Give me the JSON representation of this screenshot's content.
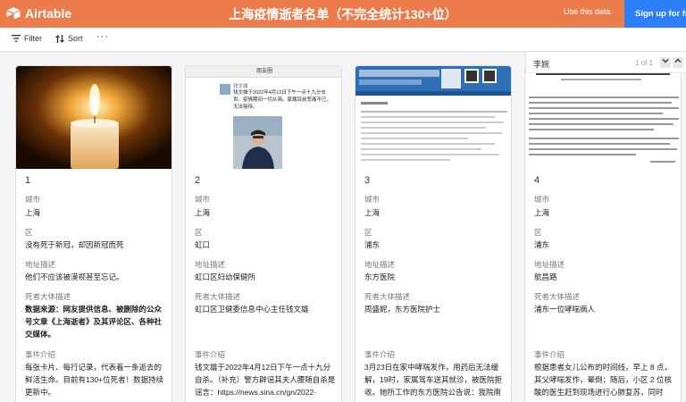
{
  "app": {
    "brand": "Airtable",
    "title": "上海疫情逝者名单（不完全统计130+位）",
    "use_data_label": "Use this data",
    "signup_label": "Sign up for free"
  },
  "toolbar": {
    "filter_label": "Filter",
    "sort_label": "Sort",
    "more_label": "···"
  },
  "field_labels": {
    "city": "城市",
    "district": "区",
    "address": "地址描述",
    "description": "死者大体描述",
    "event": "事件介绍"
  },
  "cards": [
    {
      "num": "1",
      "city": "上海",
      "district": "没有死于新冠，却因新冠而死",
      "address": "他们不应该被漠视甚至忘记。",
      "description": "数据来源：网友提供信息、被删除的公众号文章《上海逝者》及其评论区、各种社交媒体。",
      "event": "每张卡片、每行记录，代表着一条逝去的鲜活生命。目前有130+位死者！数据持续更新中。"
    },
    {
      "num": "2",
      "city": "上海",
      "district": "虹口",
      "address": "虹口区妇幼保健所",
      "description": "虹口区卫健委信息中心主任钱文雄",
      "event": "钱文雄于2022年4月12日下午一点十九分自杀。（补充）警方辟谣其夫人腰随自杀是谣言：https://news.sina.cn/gn/2022-",
      "screenshot_header": "朋友圈",
      "screenshot_name": "钱文雄",
      "screenshot_text": "钱文雄于2022年4月12日下午一点十九分去世。疫情期间一切从简。家属目前悲痛不已，无法接待。"
    },
    {
      "num": "3",
      "city": "上海",
      "district": "浦东",
      "address": "东方医院",
      "description": "周盛妮，东方医院护士",
      "event": "3月23日在家中哮喘发作，用药后无法缓解，19时，家属驾车送其就诊，被医院拒收。她所工作的东方医院公告说：我院南"
    },
    {
      "num": "4",
      "city": "上海",
      "district": "浦东",
      "address": "航昌路",
      "description": "浦东一位哮喘病人",
      "event": "根据患者女儿公布的时间线，早上 8 点，其父哮喘发作，晕倒；随后，小区 2 位核酸的医生赶到现场进行心肺复苏，同时"
    }
  ],
  "detail_panel": {
    "title": "李婉",
    "pager": "1 of 1"
  }
}
